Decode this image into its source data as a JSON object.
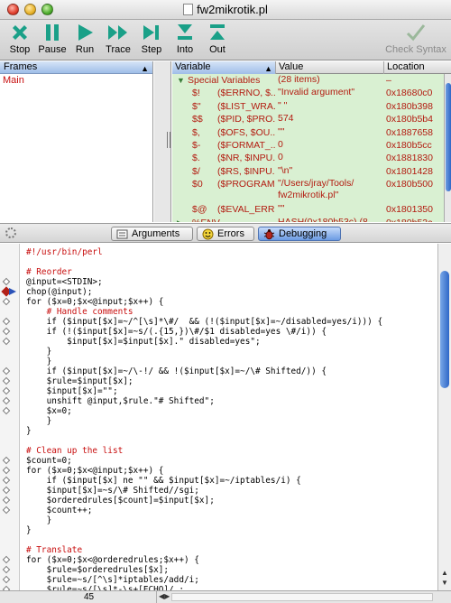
{
  "window": {
    "title": "fw2mikrotik.pl"
  },
  "toolbar": {
    "stop": "Stop",
    "pause": "Pause",
    "run": "Run",
    "trace": "Trace",
    "step": "Step",
    "into": "Into",
    "out": "Out",
    "check_syntax": "Check Syntax"
  },
  "frames": {
    "header": "Frames",
    "items": [
      "Main"
    ]
  },
  "variables": {
    "headers": {
      "name": "Variable",
      "value": "Value",
      "location": "Location"
    },
    "group": {
      "name": "Special Variables",
      "value": "(28 items)",
      "location": "–"
    },
    "rows": [
      {
        "sym": "$!",
        "name": "($ERRNO, $...",
        "value": "\"Invalid argument\"",
        "loc": "0x18680c0"
      },
      {
        "sym": "$\"",
        "name": "($LIST_WRA...",
        "value": "\" \"",
        "loc": "0x180b398"
      },
      {
        "sym": "$$",
        "name": "($PID, $PRO...",
        "value": "574",
        "loc": "0x180b5b4"
      },
      {
        "sym": "$,",
        "name": "($OFS, $OU...",
        "value": "\"\"",
        "loc": "0x1887658"
      },
      {
        "sym": "$-",
        "name": "($FORMAT_...",
        "value": "0",
        "loc": "0x180b5cc"
      },
      {
        "sym": "$.",
        "name": "($NR, $INPU...",
        "value": "0",
        "loc": "0x1881830"
      },
      {
        "sym": "$/",
        "name": "($RS, $INPU...",
        "value": "\"\\n\"",
        "loc": "0x1801428"
      },
      {
        "sym": "$0",
        "name": "($PROGRAM...",
        "value": "\"/Users/jray/Tools/ fw2mikrotik.pl\"",
        "loc": "0x180b500",
        "tall": true
      },
      {
        "sym": "$@",
        "name": "($EVAL_ERR...",
        "value": "\"\"",
        "loc": "0x1801350"
      }
    ],
    "env": {
      "name": "%ENV",
      "value": "HASH(0x180b53c) (8",
      "location": "0x180b53c"
    }
  },
  "tabs": {
    "arguments": "Arguments",
    "errors": "Errors",
    "debugging": "Debugging"
  },
  "code_lines": [
    {
      "text": "#!/usr/bin/perl",
      "comment": true,
      "marker": ""
    },
    {
      "text": "",
      "marker": ""
    },
    {
      "text": "# Reorder",
      "comment": true,
      "marker": ""
    },
    {
      "text": "@input=<STDIN>;",
      "marker": "dia"
    },
    {
      "text": "chop(@input);",
      "marker": "current"
    },
    {
      "text": "for ($x=0;$x<@input;$x++) {",
      "marker": "dia"
    },
    {
      "text": "    # Handle comments",
      "comment": true,
      "marker": ""
    },
    {
      "text": "    if ($input[$x]=~/^[\\s]*\\#/  && (!($input[$x]=~/disabled=yes/i))) {",
      "marker": "dia"
    },
    {
      "text": "    if (!($input[$x]=~s/(.{15,})\\#/$1 disabled=yes \\#/i)) {",
      "marker": "dia"
    },
    {
      "text": "        $input[$x]=$input[$x].\" disabled=yes\";",
      "marker": "dia"
    },
    {
      "text": "    }",
      "marker": ""
    },
    {
      "text": "    }",
      "marker": ""
    },
    {
      "text": "    if ($input[$x]=~/\\-!/ && !($input[$x]=~/\\# Shifted/)) {",
      "marker": "dia"
    },
    {
      "text": "    $rule=$input[$x];",
      "marker": "dia"
    },
    {
      "text": "    $input[$x]=\"\";",
      "marker": "dia"
    },
    {
      "text": "    unshift @input,$rule.\"# Shifted\";",
      "marker": "dia"
    },
    {
      "text": "    $x=0;",
      "marker": "dia"
    },
    {
      "text": "    }",
      "marker": ""
    },
    {
      "text": "}",
      "marker": ""
    },
    {
      "text": "",
      "marker": ""
    },
    {
      "text": "# Clean up the list",
      "comment": true,
      "marker": ""
    },
    {
      "text": "$count=0;",
      "marker": "dia"
    },
    {
      "text": "for ($x=0;$x<@input;$x++) {",
      "marker": "dia"
    },
    {
      "text": "    if ($input[$x] ne \"\" && $input[$x]=~/iptables/i) {",
      "marker": "dia"
    },
    {
      "text": "    $input[$x]=~s/\\# Shifted//sgi;",
      "marker": "dia"
    },
    {
      "text": "    $orderedrules[$count]=$input[$x];",
      "marker": "dia"
    },
    {
      "text": "    $count++;",
      "marker": "dia"
    },
    {
      "text": "    }",
      "marker": ""
    },
    {
      "text": "}",
      "marker": ""
    },
    {
      "text": "",
      "marker": ""
    },
    {
      "text": "# Translate",
      "comment": true,
      "marker": ""
    },
    {
      "text": "for ($x=0;$x<@orderedrules;$x++) {",
      "marker": "dia"
    },
    {
      "text": "    $rule=$orderedrules[$x];",
      "marker": "dia"
    },
    {
      "text": "    $rule=~s/[^\\s]*iptables/add/i;",
      "marker": "dia"
    },
    {
      "text": "    $rule=~s/[\\s]*-\\s+[ECHO]/ ;",
      "marker": "dia"
    }
  ],
  "status": {
    "line": "45"
  }
}
